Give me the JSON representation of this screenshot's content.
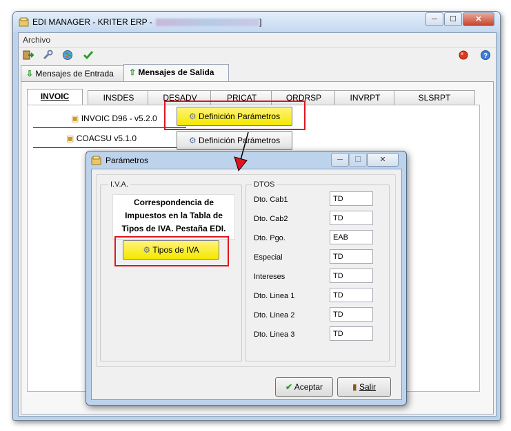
{
  "window": {
    "title": "EDI MANAGER - KRITER ERP - ",
    "title_suffix": "]",
    "minimize": "─",
    "maximize": "☐",
    "close": "✕"
  },
  "menu": {
    "archivo": "Archivo"
  },
  "toolbar_icons": [
    "exit-icon",
    "wrench-icon",
    "globe-icon",
    "check-icon",
    "record-icon",
    "help-icon"
  ],
  "outer_tabs": [
    {
      "label": "Mensajes de Entrada",
      "icon": "arrow-down-icon"
    },
    {
      "label": "Mensajes de Salida",
      "icon": "arrow-up-icon"
    }
  ],
  "inner_tabs": [
    "INVOIC",
    "INSDES",
    "DESADV",
    "PRICAT",
    "ORDRSP",
    "INVRPT",
    "SLSRPT"
  ],
  "rows": [
    {
      "label": "INVOIC D96 - v5.2.0",
      "button": "Definición Parámetros"
    },
    {
      "label": "COACSU v5.1.0",
      "button": "Definición Parámetros"
    }
  ],
  "dialog": {
    "title": "Parámetros",
    "iva_group_title": "I.V.A.",
    "iva_note": "Correspondencia de Impuestos en la Tabla de Tipos de IVA. Pestaña EDI.",
    "tipos_button": "Tipos de IVA",
    "dtos_group_title": "DTOS",
    "fields": [
      {
        "label": "Dto. Cab1",
        "value": "TD"
      },
      {
        "label": "Dto. Cab2",
        "value": "TD"
      },
      {
        "label": "Dto. Pgo.",
        "value": "EAB"
      },
      {
        "label": "Especial",
        "value": "TD"
      },
      {
        "label": "Intereses",
        "value": "TD"
      },
      {
        "label": "Dto. Linea 1",
        "value": "TD"
      },
      {
        "label": "Dto. Linea 2",
        "value": "TD"
      },
      {
        "label": "Dto. Linea 3",
        "value": "TD"
      }
    ],
    "accept_button": "Aceptar",
    "exit_button": "Salir"
  },
  "colors": {
    "highlight": "#e0141c",
    "button_yellow": "#f5e800",
    "window_frame": "#bcd3ec"
  }
}
